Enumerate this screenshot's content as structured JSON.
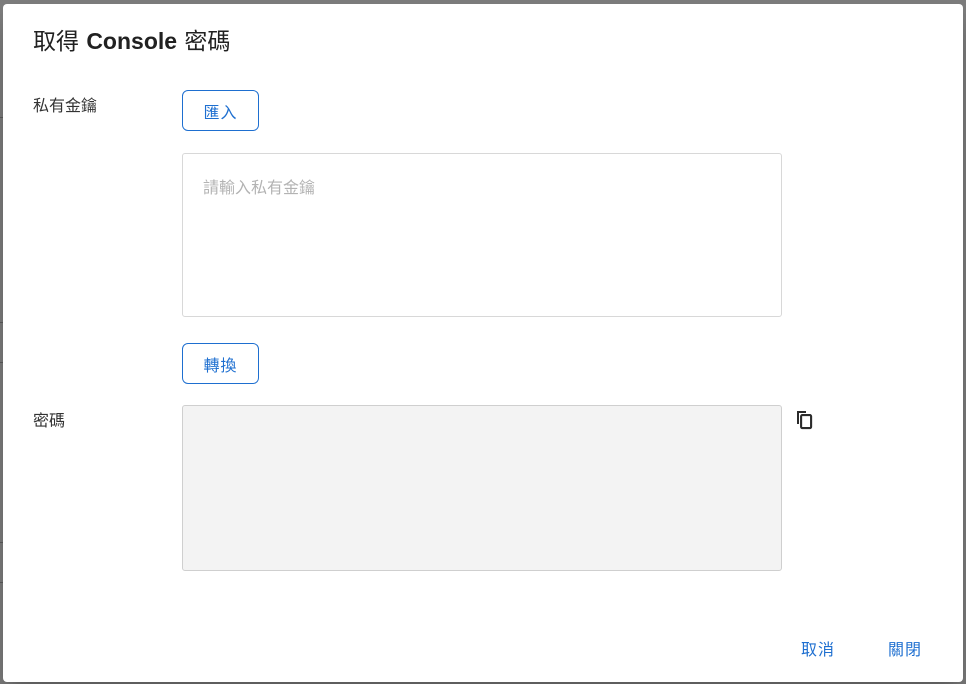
{
  "dialog": {
    "title_prefix": "取得 ",
    "title_brand": "Console",
    "title_suffix": " 密碼"
  },
  "private_key": {
    "label": "私有金鑰",
    "import_label": "匯入",
    "placeholder": "請輸入私有金鑰",
    "value": "",
    "convert_label": "轉換"
  },
  "password": {
    "label": "密碼",
    "value": ""
  },
  "actions": {
    "cancel_label": "取消",
    "close_label": "關閉"
  },
  "icons": {
    "copy": "copy-icon"
  }
}
